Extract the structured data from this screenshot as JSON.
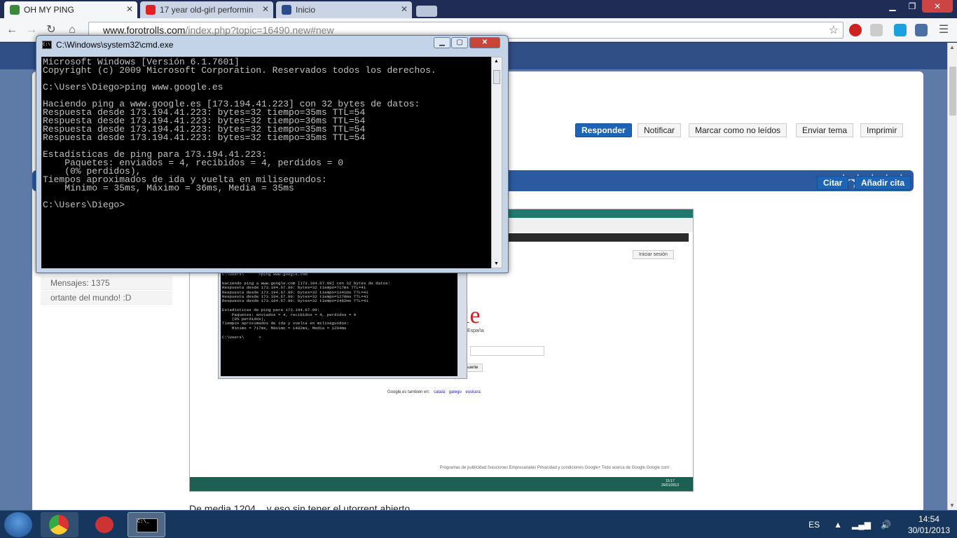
{
  "browser": {
    "tabs": [
      {
        "title": "OH MY PING",
        "favicon_color": "#3a8a3a"
      },
      {
        "title": "17 year old-girl performin",
        "favicon_color": "#d22"
      },
      {
        "title": "Inicio",
        "favicon_color": "#2a4c8c"
      }
    ],
    "url_host": "www.forotrolls.com",
    "url_path": "/index.php?topic=16490.new#new"
  },
  "forum": {
    "buttons": {
      "reply": "Responder",
      "notify": "Notificar",
      "mark_unread": "Marcar como no leídos",
      "send_topic": "Enviar tema",
      "print": "Imprimir",
      "quote": "Citar",
      "add_quote": "Añadir cita"
    },
    "rating_stars": 5,
    "sidebar": {
      "posts": "Mensajes: 1375",
      "signature": "ortante del mundo! :D"
    },
    "post_text": "De media 1204... y eso sin tener el utorrent abierto"
  },
  "inner_screenshot": {
    "login": "Iniciar sesión",
    "logo": "le",
    "espana": "España",
    "suerte": "r suerte",
    "langs_label": "Google.es también en:",
    "langs": [
      "català",
      "galego",
      "euskara"
    ],
    "footer": "Programas de publicidad    Soluciones Empresariales    Privacidad y condiciones    Google+    Todo acerca de Google    Google.com",
    "clock_time": "15:17",
    "clock_date": "26/01/2013",
    "cmd_text": "C:\\Users\\      >ping www.google.com\n\nHaciendo ping a www.google.com [173.194.67.99] con 32 bytes de datos:\nRespuesta desde 173.194.67.99: bytes=32 tiempo=717ms TTL=41\nRespuesta desde 173.194.67.99: bytes=32 tiempo=1341ms TTL=41\nRespuesta desde 173.194.67.99: bytes=32 tiempo=1270ms TTL=41\nRespuesta desde 173.194.67.99: bytes=32 tiempo=1482ms TTL=41\n\nEstadísticas de ping para 173.194.67.99:\n    Paquetes: enviados = 4, recibidos = 4, perdidos = 0\n    (0% perdidos),\nTiempos aproximados de ida y vuelta en milisegundos:\n    Mínimo = 717ms, Máximo = 1482ms, Media = 1204ms\n\nC:\\Users\\      >"
  },
  "cmd": {
    "title": "C:\\Windows\\system32\\cmd.exe",
    "output": "Microsoft Windows [Versión 6.1.7601]\nCopyright (c) 2009 Microsoft Corporation. Reservados todos los derechos.\n\nC:\\Users\\Diego>ping www.google.es\n\nHaciendo ping a www.google.es [173.194.41.223] con 32 bytes de datos:\nRespuesta desde 173.194.41.223: bytes=32 tiempo=35ms TTL=54\nRespuesta desde 173.194.41.223: bytes=32 tiempo=36ms TTL=54\nRespuesta desde 173.194.41.223: bytes=32 tiempo=35ms TTL=54\nRespuesta desde 173.194.41.223: bytes=32 tiempo=35ms TTL=54\n\nEstadísticas de ping para 173.194.41.223:\n    Paquetes: enviados = 4, recibidos = 4, perdidos = 0\n    (0% perdidos),\nTiempos aproximados de ida y vuelta en milisegundos:\n    Mínimo = 35ms, Máximo = 36ms, Media = 35ms\n\nC:\\Users\\Diego>"
  },
  "taskbar": {
    "lang": "ES",
    "time": "14:54",
    "date": "30/01/2013"
  }
}
